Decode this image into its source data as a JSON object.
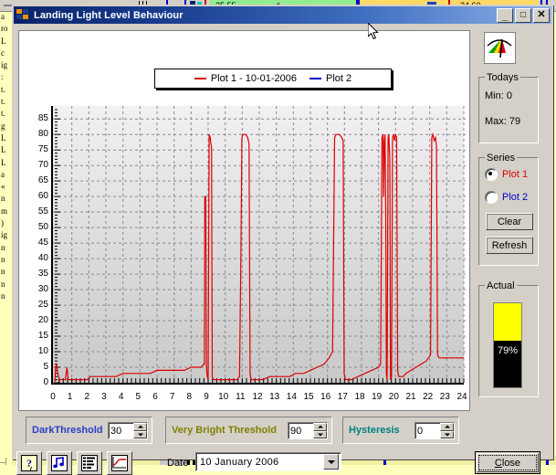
{
  "window": {
    "title": "Landing Light Level Behaviour",
    "icon": "app-squares-icon",
    "buttons": {
      "minimize": "_",
      "maximize": "□",
      "close": "✕"
    }
  },
  "legend": {
    "items": [
      {
        "label": "Plot 1 - 10-01-2006",
        "color": "#dd0000"
      },
      {
        "label": "Plot 2",
        "color": "#0000cc"
      }
    ]
  },
  "side": {
    "meter_icon": "light-meter-icon",
    "todays": {
      "title": "Todays",
      "min_label": "Min: 0",
      "max_label": "Max: 79"
    },
    "series": {
      "title": "Series",
      "options": [
        {
          "label": "Plot 1",
          "color": "#dd0000",
          "selected": true
        },
        {
          "label": "Plot 2",
          "color": "#0000cc",
          "selected": false
        }
      ],
      "clear_label": "Clear",
      "refresh_label": "Refresh"
    },
    "actual": {
      "title": "Actual",
      "value_text": "79%",
      "percent": 79,
      "fill_color": "#ffff00"
    }
  },
  "thresholds": [
    {
      "name": "dark",
      "label": "DarkThreshold",
      "value": "30",
      "color": "#2a3fc8"
    },
    {
      "name": "very-bright",
      "label": "Very Bright Threshold",
      "value": "90",
      "color": "#808000"
    },
    {
      "name": "hysteresis",
      "label": "Hysteresis",
      "value": "0",
      "color": "#008080"
    }
  ],
  "toolbar": {
    "buttons": [
      {
        "name": "help",
        "icon": "question-mark-icon"
      },
      {
        "name": "sound",
        "icon": "music-note-icon"
      },
      {
        "name": "list",
        "icon": "list-lines-icon"
      },
      {
        "name": "graph",
        "icon": "graph-curve-icon"
      }
    ],
    "date_label": "Date",
    "date_value": "10   January   2006",
    "close_label": "Close",
    "close_accesskey": "C"
  },
  "chart_data": {
    "type": "line",
    "title": "",
    "xlabel": "",
    "ylabel": "",
    "xlim": [
      0,
      24
    ],
    "ylim": [
      0,
      88
    ],
    "grid": true,
    "legend_position": "top",
    "xticks": [
      0,
      1,
      2,
      3,
      4,
      5,
      6,
      7,
      8,
      9,
      10,
      11,
      12,
      13,
      14,
      15,
      16,
      17,
      18,
      19,
      20,
      21,
      22,
      23,
      24
    ],
    "yticks": [
      0,
      5,
      10,
      15,
      20,
      25,
      30,
      35,
      40,
      45,
      50,
      55,
      60,
      65,
      70,
      75,
      80,
      85
    ],
    "series": [
      {
        "name": "Plot 1 - 10-01-2006",
        "color": "#dd0000",
        "points": [
          [
            0.0,
            0
          ],
          [
            0.05,
            5
          ],
          [
            0.1,
            6
          ],
          [
            0.15,
            4
          ],
          [
            0.22,
            2
          ],
          [
            0.3,
            1
          ],
          [
            0.45,
            1
          ],
          [
            0.62,
            1
          ],
          [
            0.72,
            5
          ],
          [
            0.78,
            1
          ],
          [
            0.85,
            1
          ],
          [
            1.0,
            1
          ],
          [
            1.4,
            1
          ],
          [
            1.9,
            1
          ],
          [
            2.1,
            2
          ],
          [
            3.0,
            2
          ],
          [
            3.6,
            2
          ],
          [
            4.0,
            3
          ],
          [
            5.0,
            3
          ],
          [
            5.6,
            3
          ],
          [
            6.0,
            4
          ],
          [
            7.0,
            4
          ],
          [
            7.6,
            4
          ],
          [
            8.0,
            5
          ],
          [
            8.6,
            5
          ],
          [
            8.74,
            6
          ],
          [
            8.78,
            6
          ],
          [
            8.8,
            60
          ],
          [
            8.86,
            60
          ],
          [
            8.9,
            5
          ],
          [
            8.95,
            2
          ],
          [
            9.0,
            1
          ],
          [
            9.06,
            80
          ],
          [
            9.12,
            79
          ],
          [
            9.16,
            77
          ],
          [
            9.2,
            76
          ],
          [
            9.24,
            2
          ],
          [
            9.3,
            1
          ],
          [
            9.6,
            1
          ],
          [
            10.0,
            1
          ],
          [
            10.4,
            1
          ],
          [
            10.7,
            1
          ],
          [
            10.84,
            2
          ],
          [
            10.92,
            40
          ],
          [
            10.98,
            79
          ],
          [
            11.05,
            80
          ],
          [
            11.2,
            80
          ],
          [
            11.32,
            79
          ],
          [
            11.4,
            77
          ],
          [
            11.46,
            3
          ],
          [
            11.52,
            1
          ],
          [
            11.8,
            1
          ],
          [
            12.2,
            1
          ],
          [
            12.6,
            2
          ],
          [
            13.0,
            2
          ],
          [
            13.4,
            2
          ],
          [
            13.8,
            2
          ],
          [
            14.1,
            3
          ],
          [
            14.6,
            3
          ],
          [
            15.0,
            4
          ],
          [
            15.4,
            5
          ],
          [
            15.8,
            6
          ],
          [
            16.1,
            8
          ],
          [
            16.3,
            10
          ],
          [
            16.42,
            79
          ],
          [
            16.5,
            80
          ],
          [
            16.7,
            80
          ],
          [
            16.84,
            79
          ],
          [
            16.92,
            78
          ],
          [
            16.98,
            3
          ],
          [
            17.05,
            1
          ],
          [
            17.4,
            1
          ],
          [
            17.8,
            2
          ],
          [
            18.2,
            3
          ],
          [
            18.6,
            4
          ],
          [
            19.0,
            5
          ],
          [
            19.12,
            6
          ],
          [
            19.2,
            79
          ],
          [
            19.26,
            80
          ],
          [
            19.3,
            60
          ],
          [
            19.34,
            78
          ],
          [
            19.38,
            80
          ],
          [
            19.42,
            56
          ],
          [
            19.46,
            3
          ],
          [
            19.5,
            1
          ],
          [
            19.56,
            79
          ],
          [
            19.6,
            80
          ],
          [
            19.66,
            72
          ],
          [
            19.7,
            1
          ],
          [
            19.76,
            2
          ],
          [
            19.82,
            79
          ],
          [
            19.88,
            80
          ],
          [
            19.94,
            78
          ],
          [
            20.0,
            80
          ],
          [
            20.06,
            79
          ],
          [
            20.12,
            4
          ],
          [
            20.18,
            2
          ],
          [
            20.3,
            2
          ],
          [
            20.45,
            2
          ],
          [
            20.6,
            3
          ],
          [
            20.9,
            4
          ],
          [
            21.2,
            5
          ],
          [
            21.5,
            6
          ],
          [
            21.8,
            7
          ],
          [
            22.05,
            9
          ],
          [
            22.12,
            79
          ],
          [
            22.18,
            80
          ],
          [
            22.26,
            78
          ],
          [
            22.34,
            79
          ],
          [
            22.4,
            76
          ],
          [
            22.46,
            9
          ],
          [
            22.55,
            8
          ],
          [
            22.8,
            8
          ],
          [
            23.2,
            8
          ],
          [
            23.6,
            8
          ],
          [
            24.0,
            8
          ]
        ]
      },
      {
        "name": "Plot 2",
        "color": "#0000cc",
        "points": []
      }
    ]
  },
  "background_app": {
    "left_text_lines": [
      "a",
      "ro",
      "L",
      "c",
      "ig",
      ":",
      "t.",
      "t.",
      "t.",
      "g",
      "L",
      "L",
      "L",
      "a",
      "«",
      "n",
      "m",
      ")",
      "ig",
      "n",
      "n",
      "n",
      "n",
      "n"
    ],
    "strip_values": [
      "25.55",
      "24.60"
    ]
  }
}
